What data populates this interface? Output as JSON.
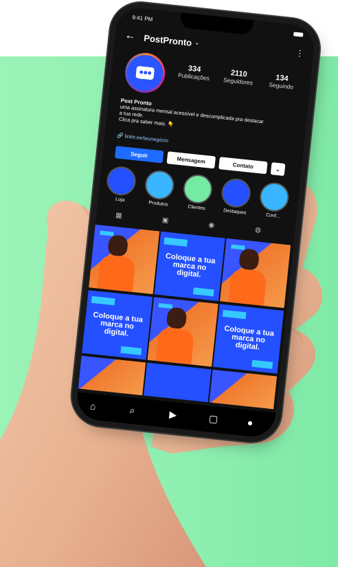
{
  "status": {
    "time": "9:41 PM"
  },
  "profile": {
    "username": "PostPronto",
    "stats": [
      {
        "number": "334",
        "label": "Publicações"
      },
      {
        "number": "2110",
        "label": "Seguidores"
      },
      {
        "number": "134",
        "label": "Seguindo"
      }
    ],
    "bio_name": "Post Pronto",
    "bio_line1": "uma assinatura mensal acessível e descomplicada pra destacar",
    "bio_line2": "a tua rede.",
    "bio_line3": "Clica pra saber mais. 👇",
    "link": "linktr.ee/teunegócio"
  },
  "buttons": {
    "follow": "Seguir",
    "message": "Mensagem",
    "contact": "Contato"
  },
  "highlights": [
    "Loja",
    "Produtos",
    "Clientes",
    "Destaques",
    "Conf..."
  ],
  "highlight_colors": [
    "#2450ff",
    "#39b6ff",
    "#74eaa3",
    "#2450ff",
    "#39b6ff"
  ],
  "post_text": "Coloque a tua marca no digital."
}
